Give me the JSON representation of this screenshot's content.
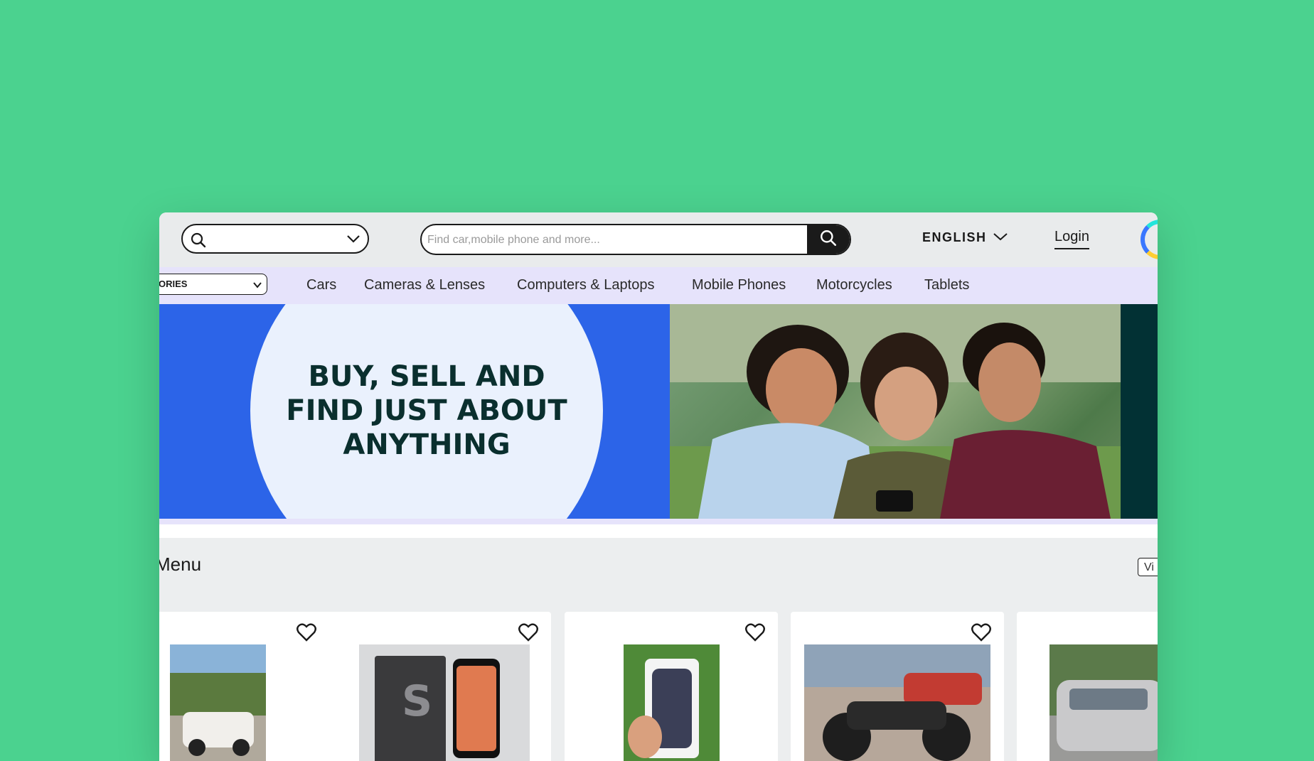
{
  "header": {
    "location_value": "",
    "search_placeholder": "Find car,mobile phone and more...",
    "language": "ENGLISH",
    "login": "Login"
  },
  "categories": {
    "all_label": "ORIES",
    "items": [
      "Cars",
      "Cameras & Lenses",
      "Computers & Laptops",
      "Mobile Phones",
      "Motorcycles",
      "Tablets"
    ]
  },
  "banner": {
    "headline_line1": "BUY, SELL AND",
    "headline_line2": "FIND JUST ABOUT",
    "headline_line3": "ANYTHING"
  },
  "menu": {
    "title": "Menu",
    "view_button": "Vi"
  },
  "colors": {
    "page_bg": "#4bd28f",
    "banner_blue": "#2c64e8",
    "catbar": "#e6e3fb"
  }
}
